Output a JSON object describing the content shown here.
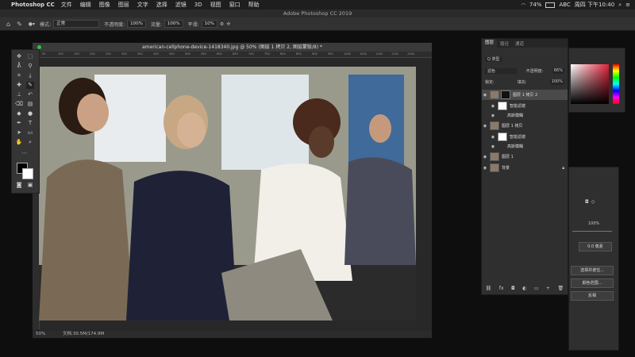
{
  "menubar": {
    "app_name": "Photoshop CC",
    "items": [
      "文件",
      "编辑",
      "图像",
      "图层",
      "文字",
      "选择",
      "滤镜",
      "3D",
      "视图",
      "窗口",
      "帮助"
    ],
    "battery": "74%",
    "input_method": "ABC",
    "datetime": "周四 下午10:40"
  },
  "ps_title": "Adobe Photoshop CC 2019",
  "options": {
    "mode_label": "模式:",
    "mode_value": "正常",
    "opacity_label": "不透明度:",
    "opacity_value": "100%",
    "flow_label": "流量:",
    "flow_value": "100%",
    "smoothing_label": "平滑:",
    "smoothing_value": "10%"
  },
  "document": {
    "tab_title": "american-cellphone-device-1418340.jpg @ 50% (图层 1 拷贝 2, 图层蒙版/8) *",
    "ruler_marks": [
      "50",
      "100",
      "150",
      "200",
      "250",
      "300",
      "350",
      "400",
      "450",
      "500",
      "550",
      "600",
      "650",
      "700",
      "750",
      "800",
      "850",
      "900",
      "950",
      "1000",
      "1050",
      "1100",
      "1150",
      "1200"
    ],
    "zoom": "50%",
    "doc_size": "文档:30.5M/174.9M"
  },
  "layers_panel": {
    "tabs": [
      "图层",
      "路径",
      "通道"
    ],
    "kind_label": "Q 类型",
    "blend_mode": "滤色",
    "opacity_label": "不透明度:",
    "opacity_value": "66%",
    "lock_label": "锁定:",
    "fill_label": "填充:",
    "fill_value": "100%",
    "layers": [
      {
        "name": "图层 1 拷贝 2",
        "kind": "layer-mask"
      },
      {
        "name": "智能滤镜",
        "kind": "smart-filter"
      },
      {
        "name": "高斯模糊",
        "kind": "filter"
      },
      {
        "name": "图层 1 拷贝",
        "kind": "layer"
      },
      {
        "name": "智能滤镜",
        "kind": "smart-filter"
      },
      {
        "name": "高斯模糊",
        "kind": "filter"
      },
      {
        "name": "图层 1",
        "kind": "layer"
      },
      {
        "name": "背景",
        "kind": "background"
      }
    ]
  },
  "properties_panel": {
    "density_value": "100%",
    "feather_value": "0.0 像素",
    "select_and_mask_label": "选择并遮住...",
    "color_range_label": "颜色范围...",
    "invert_label": "反相"
  },
  "colors": {
    "accent": "#2d8cf0",
    "workspace_bg": "#0e0e0e",
    "panel_bg": "#2f2f2f"
  }
}
